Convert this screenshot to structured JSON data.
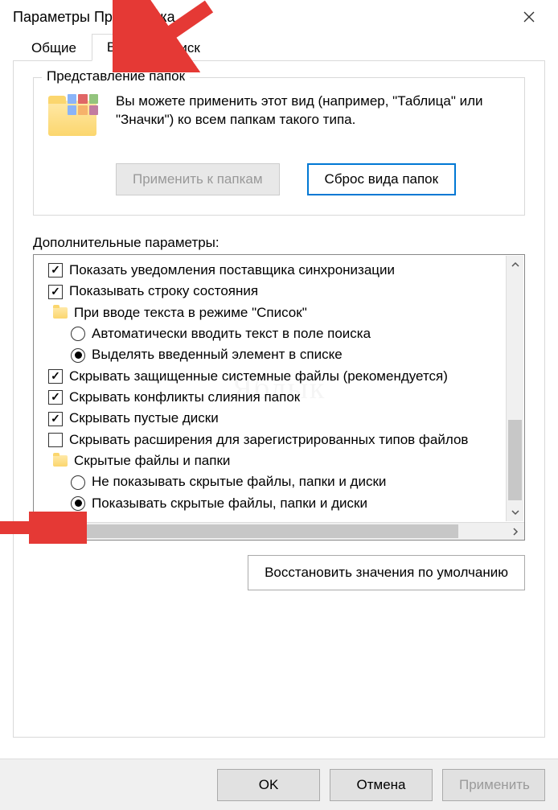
{
  "window": {
    "title": "Параметры Проводника"
  },
  "tabs": {
    "general": "Общие",
    "view": "Вид",
    "search": "Поиск"
  },
  "groupbox": {
    "legend": "Представление папок",
    "text": "Вы можете применить этот вид (например, \"Таблица\" или \"Значки\") ко всем папкам такого типа.",
    "apply_btn": "Применить к папкам",
    "reset_btn": "Сброс вида папок"
  },
  "adv": {
    "label": "Дополнительные параметры:"
  },
  "opts": {
    "sync_notif": "Показать уведомления поставщика синхронизации",
    "status_bar": "Показывать строку состояния",
    "typing_header": "При вводе текста в режиме \"Список\"",
    "typing_search": "Автоматически вводить текст в поле поиска",
    "typing_select": "Выделять введенный элемент в списке",
    "hide_protected": "Скрывать защищенные системные файлы (рекомендуется)",
    "hide_merge": "Скрывать конфликты слияния папок",
    "hide_empty_drives": "Скрывать пустые диски",
    "hide_ext": "Скрывать расширения для зарегистрированных типов файлов",
    "hidden_header": "Скрытые файлы и папки",
    "hidden_no": "Не показывать скрытые файлы, папки и диски",
    "hidden_yes": "Показывать скрытые файлы, папки и диски"
  },
  "restore_btn": "Восстановить значения по умолчанию",
  "footer": {
    "ok": "OK",
    "cancel": "Отмена",
    "apply": "Применить"
  },
  "watermark": "Яблык"
}
